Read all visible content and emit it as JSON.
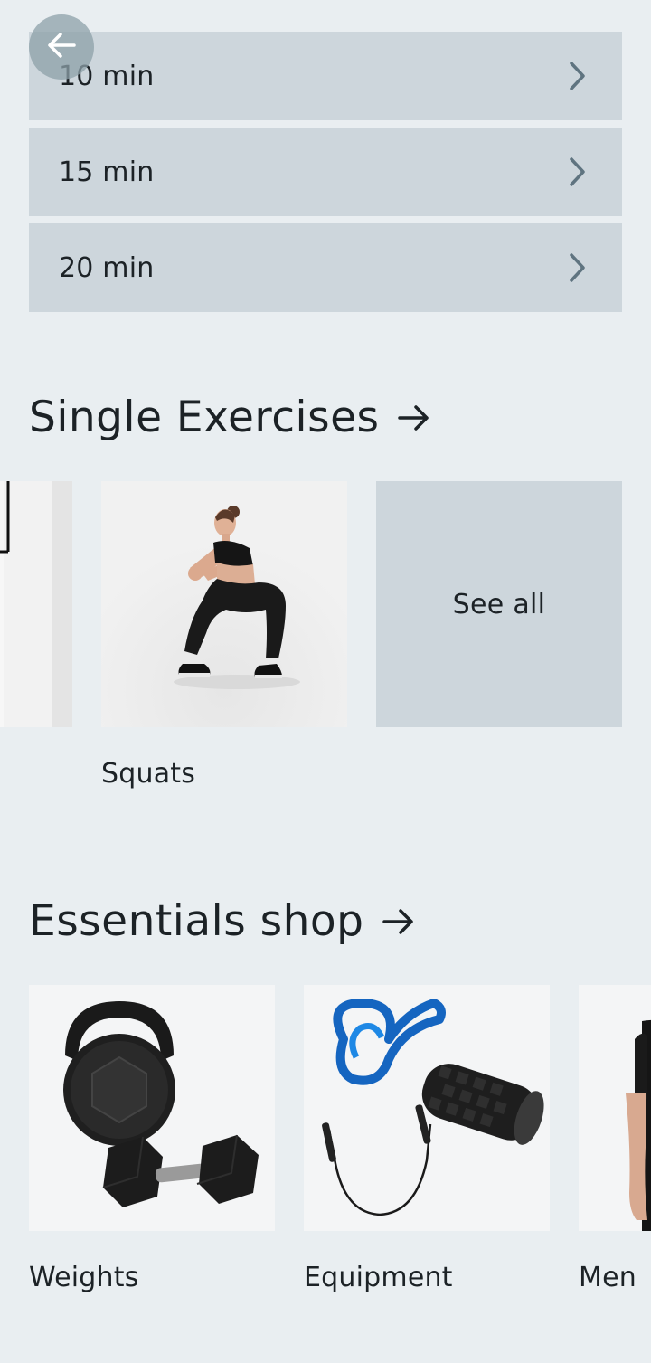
{
  "durations": [
    {
      "label": "10 min"
    },
    {
      "label": "15 min"
    },
    {
      "label": "20 min"
    }
  ],
  "single_exercises": {
    "title": "Single Exercises",
    "items": [
      {
        "label": ""
      },
      {
        "label": "Squats"
      }
    ],
    "see_all": "See all"
  },
  "essentials_shop": {
    "title": "Essentials shop",
    "items": [
      {
        "label": "Weights"
      },
      {
        "label": "Equipment"
      },
      {
        "label": "Men"
      }
    ]
  },
  "colors": {
    "background": "#e9eef1",
    "row_bg": "#cdd6dc",
    "chevron": "#5f7480",
    "text": "#1c2226"
  },
  "icons": [
    "back-arrow-icon",
    "chevron-right-icon",
    "arrow-right-icon"
  ]
}
